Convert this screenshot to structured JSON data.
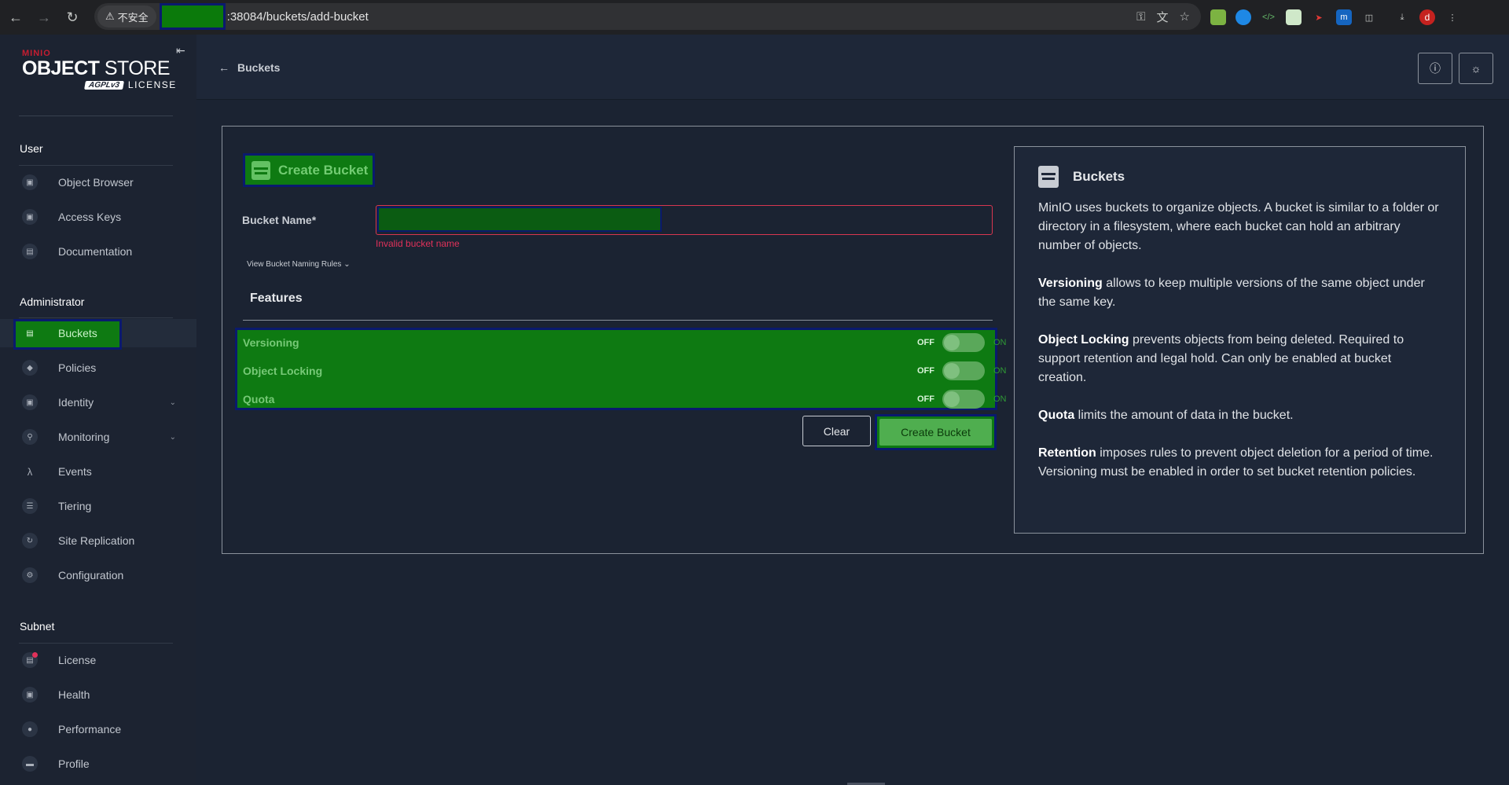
{
  "browser": {
    "security_label": "不安全",
    "url_path": ":38084/buckets/add-bucket",
    "avatar_letter": "d"
  },
  "sidebar": {
    "logo": {
      "brand": "MINIO",
      "product_bold": "OBJECT",
      "product_light": "STORE",
      "badge": "AGPLv3",
      "license": "LICENSE"
    },
    "sections": [
      {
        "title": "User",
        "items": [
          {
            "label": "Object Browser",
            "icon": "object-browser-icon"
          },
          {
            "label": "Access Keys",
            "icon": "key-icon"
          },
          {
            "label": "Documentation",
            "icon": "document-icon"
          }
        ]
      },
      {
        "title": "Administrator",
        "items": [
          {
            "label": "Buckets",
            "icon": "bucket-icon",
            "active": true
          },
          {
            "label": "Policies",
            "icon": "shield-icon"
          },
          {
            "label": "Identity",
            "icon": "identity-icon",
            "expandable": true
          },
          {
            "label": "Monitoring",
            "icon": "magnifier-icon",
            "expandable": true
          },
          {
            "label": "Events",
            "icon": "lambda-icon"
          },
          {
            "label": "Tiering",
            "icon": "layers-icon"
          },
          {
            "label": "Site Replication",
            "icon": "replication-icon"
          },
          {
            "label": "Configuration",
            "icon": "gear-icon"
          }
        ]
      },
      {
        "title": "Subnet",
        "items": [
          {
            "label": "License",
            "icon": "license-icon",
            "badge": true
          },
          {
            "label": "Health",
            "icon": "health-icon"
          },
          {
            "label": "Performance",
            "icon": "performance-icon"
          },
          {
            "label": "Profile",
            "icon": "profile-icon"
          }
        ]
      }
    ]
  },
  "header": {
    "back_label": "Buckets",
    "help_icon": "question-circle-icon",
    "theme_icon": "sun-icon"
  },
  "form": {
    "title": "Create Bucket",
    "bucket_name_label": "Bucket Name*",
    "error": "Invalid bucket name",
    "naming_rules_link": "View Bucket Naming Rules",
    "features_title": "Features",
    "features": [
      {
        "label": "Versioning",
        "off": "OFF",
        "on": "ON",
        "enabled": false
      },
      {
        "label": "Object Locking",
        "off": "OFF",
        "on": "ON",
        "enabled": false
      },
      {
        "label": "Quota",
        "off": "OFF",
        "on": "ON",
        "enabled": false
      }
    ],
    "clear_label": "Clear",
    "submit_label": "Create Bucket"
  },
  "help": {
    "title": "Buckets",
    "intro": "MinIO uses buckets to organize objects. A bucket is similar to a folder or directory in a filesystem, where each bucket can hold an arbitrary number of objects.",
    "items": [
      {
        "term": "Versioning",
        "text": " allows to keep multiple versions of the same object under the same key."
      },
      {
        "term": "Object Locking",
        "text": " prevents objects from being deleted. Required to support retention and legal hold. Can only be enabled at bucket creation."
      },
      {
        "term": "Quota",
        "text": " limits the amount of data in the bucket."
      },
      {
        "term": "Retention",
        "text": " imposes rules to prevent object deletion for a period of time. Versioning must be enabled in order to set bucket retention policies."
      }
    ]
  },
  "colors": {
    "accent_green": "#0e7a12",
    "error_red": "#e0315a",
    "background": "#1b2332"
  }
}
